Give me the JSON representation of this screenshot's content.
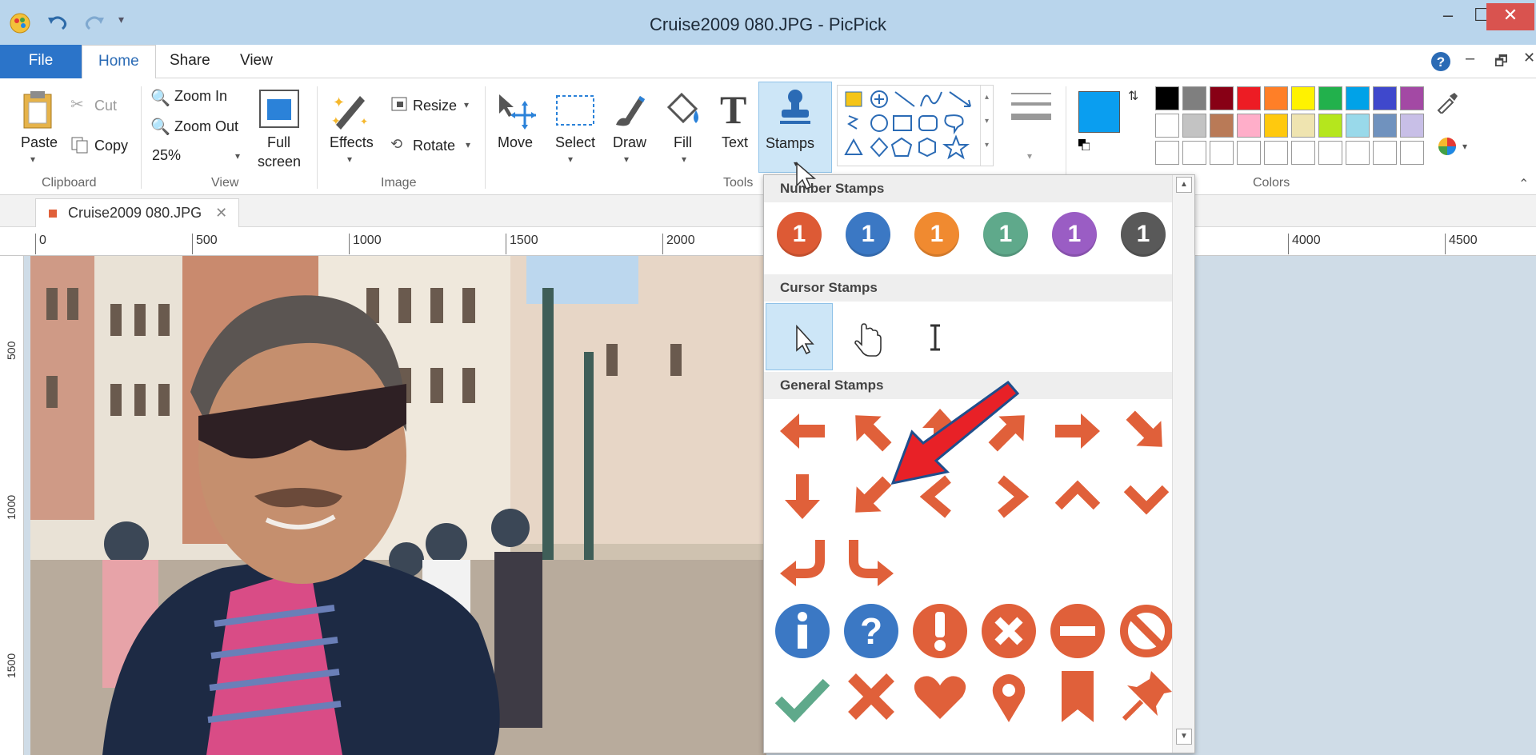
{
  "window": {
    "title": "Cruise2009 080.JPG - PicPick"
  },
  "menu": {
    "file": "File",
    "home": "Home",
    "share": "Share",
    "view": "View"
  },
  "ribbon": {
    "clipboard": {
      "paste": "Paste",
      "cut": "Cut",
      "copy": "Copy",
      "group": "Clipboard"
    },
    "view": {
      "zoom_in": "Zoom In",
      "zoom_out": "Zoom Out",
      "zoom_level": "25%",
      "full": "Full",
      "screen": "screen",
      "group": "View"
    },
    "image": {
      "effects": "Effects",
      "resize": "Resize",
      "rotate": "Rotate",
      "group": "Image"
    },
    "tools": {
      "move": "Move",
      "select": "Select",
      "draw": "Draw",
      "fill": "Fill",
      "text": "Text",
      "stamps": "Stamps",
      "group": "Tools"
    },
    "colors": {
      "group": "Colors",
      "primary": "#0a9ef0"
    },
    "palette_row1": [
      "#000000",
      "#7f7f7f",
      "#880015",
      "#ed1c24",
      "#ff7f27",
      "#fff200",
      "#22b14c",
      "#00a2e8",
      "#3f48cc",
      "#a349a4"
    ],
    "palette_row2": [
      "#ffffff",
      "#c3c3c3",
      "#b97a57",
      "#ffaec9",
      "#ffc90e",
      "#efe4b0",
      "#b5e61d",
      "#99d9ea",
      "#7092be",
      "#c8bfe7"
    ]
  },
  "document": {
    "tab": "Cruise2009 080.JPG"
  },
  "ruler": {
    "h": [
      "0",
      "500",
      "1000",
      "1500",
      "2000",
      "4000",
      "4500"
    ],
    "v": [
      "500",
      "1000",
      "1500"
    ]
  },
  "stamps_panel": {
    "number_header": "Number Stamps",
    "cursor_header": "Cursor Stamps",
    "general_header": "General Stamps",
    "number_value": "1",
    "number_colors": [
      "#dd5a35",
      "#3b78c4",
      "#f08a30",
      "#5fa98b",
      "#9a5dc4",
      "#595959"
    ],
    "stamp_color": "#e0603a"
  }
}
